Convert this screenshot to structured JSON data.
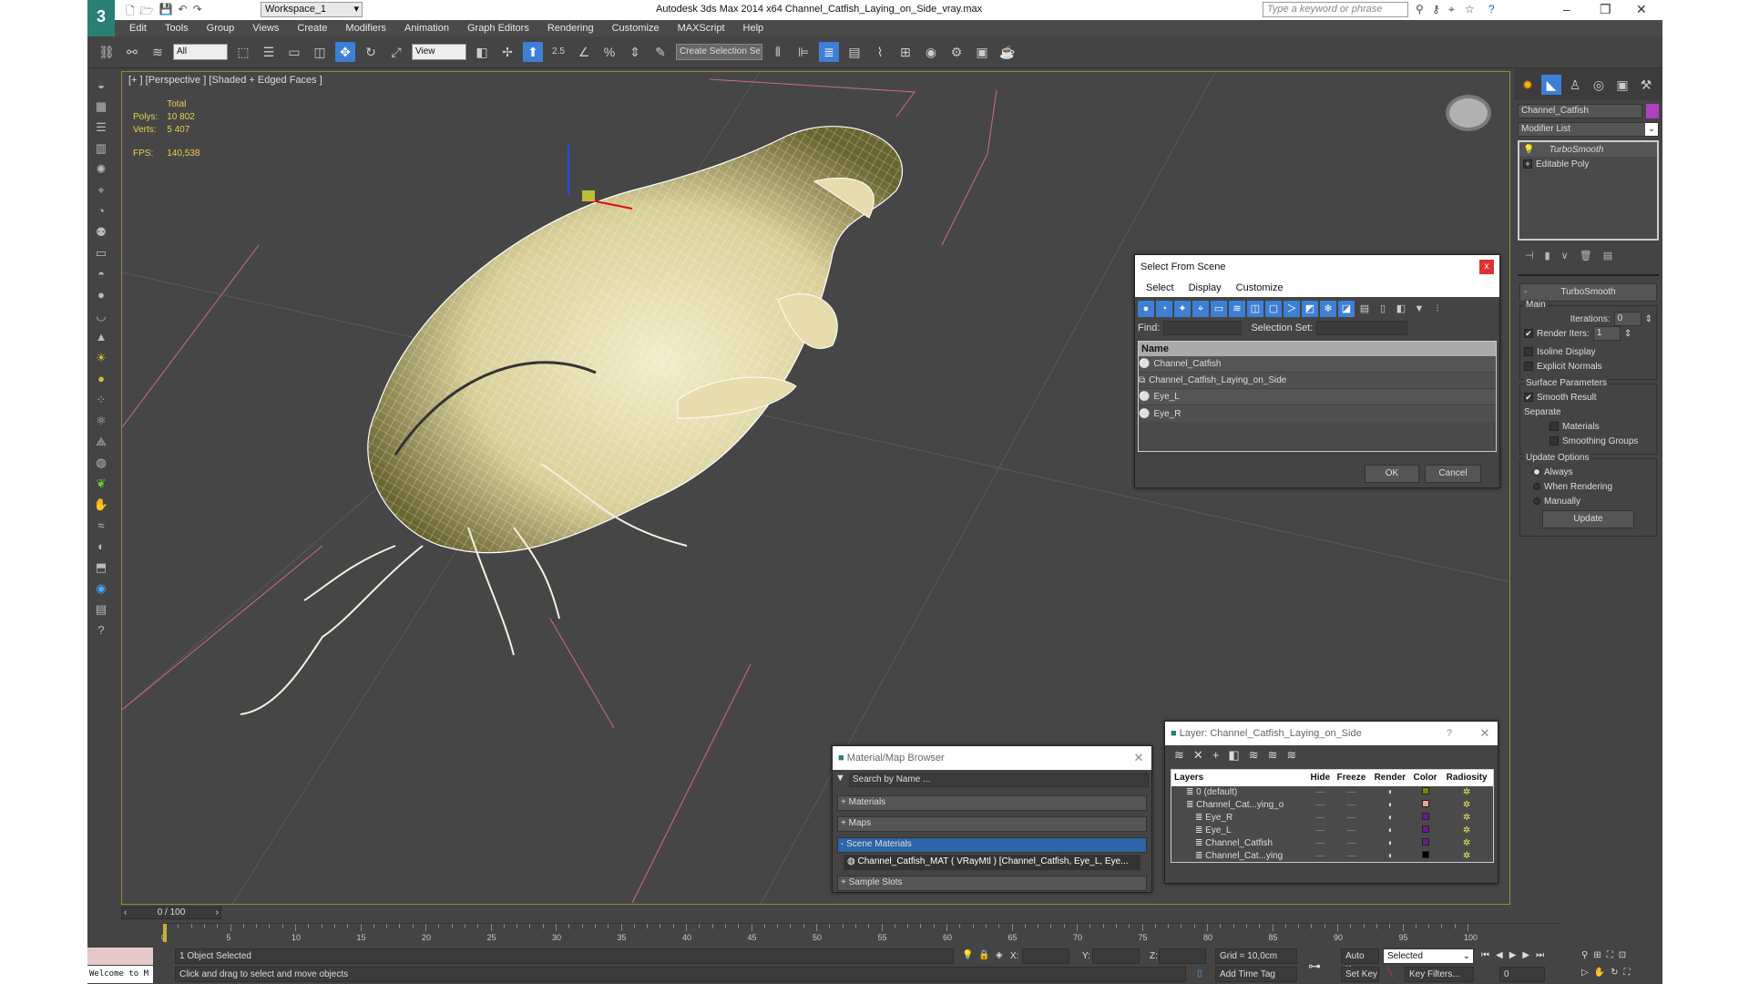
{
  "titlebar": {
    "workspace": "Workspace_1",
    "title": "Autodesk 3ds Max  2014 x64     Channel_Catfish_Laying_on_Side_vray.max",
    "search_placeholder": "Type a keyword or phrase"
  },
  "menu": [
    "Edit",
    "Tools",
    "Group",
    "Views",
    "Create",
    "Modifiers",
    "Animation",
    "Graph Editors",
    "Rendering",
    "Customize",
    "MAXScript",
    "Help"
  ],
  "toolbar": {
    "filter": "All",
    "ref_coord": "View",
    "selection_set": "Create Selection Se",
    "snap_angle": "2.5"
  },
  "viewport": {
    "label": "[+ ] [Perspective ] [Shaded + Edged Faces ]",
    "stats": {
      "total_label": "Total",
      "polys_label": "Polys:",
      "polys": "10 802",
      "verts_label": "Verts:",
      "verts": "5 407",
      "fps_label": "FPS:",
      "fps": "140,538"
    }
  },
  "command_panel": {
    "object_name": "Channel_Catfish",
    "object_color": "#b13fc4",
    "modifier_list": "Modifier List",
    "stack": [
      "TurboSmooth",
      "Editable Poly"
    ],
    "rollout": "TurboSmooth",
    "main": "Main",
    "iterations_label": "Iterations:",
    "iterations": "0",
    "render_iters_label": "Render Iters:",
    "render_iters": "1",
    "isoline": "Isoline Display",
    "explicit_normals": "Explicit Normals",
    "surface": "Surface Parameters",
    "smooth_result": "Smooth Result",
    "separate": "Separate",
    "materials": "Materials",
    "smoothing_groups": "Smoothing Groups",
    "update_options": "Update Options",
    "always": "Always",
    "when_rendering": "When Rendering",
    "manually": "Manually",
    "update": "Update"
  },
  "select_dialog": {
    "title": "Select From Scene",
    "menu": [
      "Select",
      "Display",
      "Customize"
    ],
    "find": "Find:",
    "selection_set": "Selection Set:",
    "col_name": "Name",
    "items": [
      "Channel_Catfish",
      "Channel_Catfish_Laying_on_Side",
      "Eye_L",
      "Eye_R"
    ],
    "ok": "OK",
    "cancel": "Cancel"
  },
  "material_browser": {
    "title": "Material/Map Browser",
    "search": "Search by Name ...",
    "sections": [
      "+ Materials",
      "+ Maps",
      "- Scene Materials",
      "+ Sample Slots"
    ],
    "material": "Channel_Catfish_MAT  ( VRayMtl )  [Channel_Catfish, Eye_L, Eye..."
  },
  "layer_dialog": {
    "title": "Layer: Channel_Catfish_Laying_on_Side",
    "help": "?",
    "cols": [
      "Layers",
      "Hide",
      "Freeze",
      "Render",
      "Color",
      "Radiosity"
    ],
    "rows": [
      {
        "name": "0 (default)",
        "color": "#6b8a12"
      },
      {
        "name": "Channel_Cat...ying_o",
        "color": "#e8a0a0"
      },
      {
        "name": "Eye_R",
        "color": "#6a1a8a"
      },
      {
        "name": "Eye_L",
        "color": "#6a1a8a"
      },
      {
        "name": "Channel_Catfish",
        "color": "#6a1a8a"
      },
      {
        "name": "Channel_Cat...ying",
        "color": "#000000"
      }
    ]
  },
  "timeline": {
    "frame": "0 / 100",
    "ticks": [
      "0",
      "5",
      "10",
      "15",
      "20",
      "25",
      "30",
      "35",
      "40",
      "45",
      "50",
      "55",
      "60",
      "65",
      "70",
      "75",
      "80",
      "85",
      "90",
      "95",
      "100"
    ]
  },
  "status": {
    "selected": "1 Object Selected",
    "prompt": "Click and drag to select and move objects",
    "maxscript": "Welcome to M",
    "x": "X:",
    "y": "Y:",
    "z": "Z:",
    "grid": "Grid = 10,0cm",
    "add_time_tag": "Add Time Tag",
    "auto_key": "Auto Key",
    "set_key": "Set Key",
    "key_mode": "Selected",
    "key_filters": "Key Filters...",
    "current_frame": "0"
  }
}
